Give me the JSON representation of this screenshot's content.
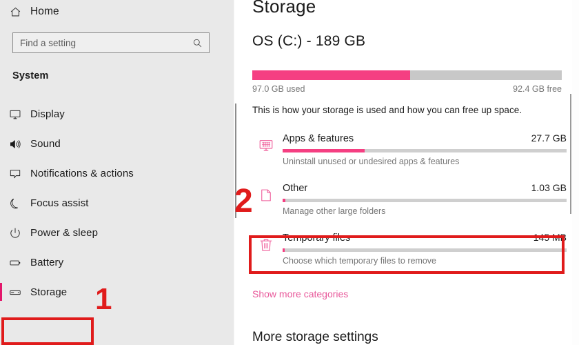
{
  "sidebar": {
    "home": {
      "label": "Home",
      "icon": "home-icon"
    },
    "search": {
      "placeholder": "Find a setting",
      "value": "",
      "icon": "search-icon"
    },
    "section_title": "System",
    "items": [
      {
        "label": "Display",
        "icon": "monitor-icon",
        "selected": false
      },
      {
        "label": "Sound",
        "icon": "speaker-icon",
        "selected": false
      },
      {
        "label": "Notifications & actions",
        "icon": "chat-bubble-icon",
        "selected": false
      },
      {
        "label": "Focus assist",
        "icon": "moon-icon",
        "selected": false
      },
      {
        "label": "Power & sleep",
        "icon": "power-icon",
        "selected": false
      },
      {
        "label": "Battery",
        "icon": "battery-icon",
        "selected": false
      },
      {
        "label": "Storage",
        "icon": "drive-icon",
        "selected": true
      }
    ]
  },
  "main": {
    "page_title": "Storage",
    "drive": {
      "title": "OS (C:) - 189 GB",
      "used_label": "97.0 GB used",
      "free_label": "92.4 GB free",
      "used_percent": 51,
      "description": "This is how your storage is used and how you can free up space."
    },
    "categories": [
      {
        "name": "Apps & features",
        "size": "27.7 GB",
        "subtitle": "Uninstall unused or undesired apps & features",
        "percent": 29,
        "icon": "apps-monitor-icon"
      },
      {
        "name": "Other",
        "size": "1.03 GB",
        "subtitle": "Manage other large folders",
        "percent": 1,
        "icon": "folder-page-icon"
      },
      {
        "name": "Temporary files",
        "size": "145 MB",
        "subtitle": "Choose which temporary files to remove",
        "percent": 0,
        "icon": "trash-icon"
      }
    ],
    "show_more_link": "Show more categories",
    "more_settings_heading": "More storage settings"
  },
  "annotations": {
    "marker_1": "1",
    "marker_2": "2",
    "highlight_color": "#e01b1b"
  },
  "colors": {
    "accent_pink": "#f53f82",
    "link_pink": "#e8589a",
    "selection_pink": "#e3176b",
    "sidebar_bg": "#e9e9e9",
    "track_gray": "#c8c8c8"
  }
}
